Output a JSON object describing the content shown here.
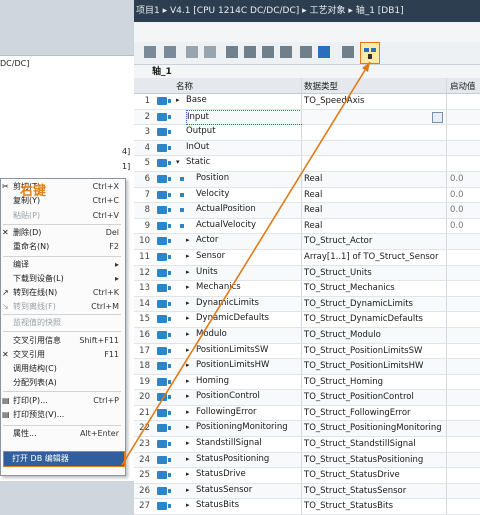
{
  "title_bar": {
    "path": "项目1 ▸ V4.1 [CPU 1214C DC/DC/DC] ▸ 工艺对象 ▸ 轴_1 [DB1]"
  },
  "left_panel": {
    "fragment_top": "DC/DC]",
    "fragment_a": "4]",
    "fragment_b": "1]"
  },
  "editor": {
    "db_name": "轴_1"
  },
  "table": {
    "headers": {
      "name": "名称",
      "type": "数据类型",
      "start": "启动值"
    },
    "rows": [
      {
        "num": "1",
        "name": "Base",
        "type": "TO_SpeedAxis",
        "start": "",
        "level": 0,
        "expander": "▸"
      },
      {
        "num": "2",
        "name": "Input",
        "type": "",
        "start": "",
        "level": 0,
        "expander": ""
      },
      {
        "num": "3",
        "name": "Output",
        "type": "",
        "start": "",
        "level": 0,
        "expander": ""
      },
      {
        "num": "4",
        "name": "InOut",
        "type": "",
        "start": "",
        "level": 0,
        "expander": ""
      },
      {
        "num": "5",
        "name": "Static",
        "type": "",
        "start": "",
        "level": 0,
        "expander": "▾"
      },
      {
        "num": "6",
        "name": "Position",
        "type": "Real",
        "start": "0.0",
        "level": 1,
        "expander": ""
      },
      {
        "num": "7",
        "name": "Velocity",
        "type": "Real",
        "start": "0.0",
        "level": 1,
        "expander": ""
      },
      {
        "num": "8",
        "name": "ActualPosition",
        "type": "Real",
        "start": "0.0",
        "level": 1,
        "expander": ""
      },
      {
        "num": "9",
        "name": "ActualVelocity",
        "type": "Real",
        "start": "0.0",
        "level": 1,
        "expander": ""
      },
      {
        "num": "10",
        "name": "Actor",
        "type": "TO_Struct_Actor",
        "start": "",
        "level": 1,
        "expander": "▸"
      },
      {
        "num": "11",
        "name": "Sensor",
        "type": "Array[1..1] of TO_Struct_Sensor",
        "start": "",
        "level": 1,
        "expander": "▸"
      },
      {
        "num": "12",
        "name": "Units",
        "type": "TO_Struct_Units",
        "start": "",
        "level": 1,
        "expander": "▸"
      },
      {
        "num": "13",
        "name": "Mechanics",
        "type": "TO_Struct_Mechanics",
        "start": "",
        "level": 1,
        "expander": "▸"
      },
      {
        "num": "14",
        "name": "DynamicLimits",
        "type": "TO_Struct_DynamicLimits",
        "start": "",
        "level": 1,
        "expander": "▸"
      },
      {
        "num": "15",
        "name": "DynamicDefaults",
        "type": "TO_Struct_DynamicDefaults",
        "start": "",
        "level": 1,
        "expander": "▸"
      },
      {
        "num": "16",
        "name": "Modulo",
        "type": "TO_Struct_Modulo",
        "start": "",
        "level": 1,
        "expander": "▸"
      },
      {
        "num": "17",
        "name": "PositionLimitsSW",
        "type": "TO_Struct_PositionLimitsSW",
        "start": "",
        "level": 1,
        "expander": "▸"
      },
      {
        "num": "18",
        "name": "PositionLimitsHW",
        "type": "TO_Struct_PositionLimitsHW",
        "start": "",
        "level": 1,
        "expander": "▸"
      },
      {
        "num": "19",
        "name": "Homing",
        "type": "TO_Struct_Homing",
        "start": "",
        "level": 1,
        "expander": "▸"
      },
      {
        "num": "20",
        "name": "PositionControl",
        "type": "TO_Struct_PositionControl",
        "start": "",
        "level": 1,
        "expander": "▸"
      },
      {
        "num": "21",
        "name": "FollowingError",
        "type": "TO_Struct_FollowingError",
        "start": "",
        "level": 1,
        "expander": "▸"
      },
      {
        "num": "22",
        "name": "PositioningMonitoring",
        "type": "TO_Struct_PositioningMonitoring",
        "start": "",
        "level": 1,
        "expander": "▸"
      },
      {
        "num": "23",
        "name": "StandstillSignal",
        "type": "TO_Struct_StandstillSignal",
        "start": "",
        "level": 1,
        "expander": "▸"
      },
      {
        "num": "24",
        "name": "StatusPositioning",
        "type": "TO_Struct_StatusPositioning",
        "start": "",
        "level": 1,
        "expander": "▸"
      },
      {
        "num": "25",
        "name": "StatusDrive",
        "type": "TO_Struct_StatusDrive",
        "start": "",
        "level": 1,
        "expander": "▸"
      },
      {
        "num": "26",
        "name": "StatusSensor",
        "type": "TO_Struct_StatusSensor",
        "start": "",
        "level": 1,
        "expander": "▸"
      },
      {
        "num": "27",
        "name": "StatusBits",
        "type": "TO_Struct_StatusBits",
        "start": "",
        "level": 1,
        "expander": "▸"
      }
    ]
  },
  "annotation": {
    "right_click": "右键"
  },
  "context_menu": {
    "items": [
      {
        "label": "剪切(T)",
        "shortcut": "Ctrl+X",
        "icon": "✂",
        "disabled": false
      },
      {
        "label": "复制(Y)",
        "shortcut": "Ctrl+C",
        "icon": "",
        "disabled": false
      },
      {
        "label": "粘贴(P)",
        "shortcut": "Ctrl+V",
        "icon": "",
        "disabled": true
      },
      {
        "label": "删除(D)",
        "shortcut": "Del",
        "icon": "✕",
        "disabled": false
      },
      {
        "label": "重命名(N)",
        "shortcut": "F2",
        "icon": "",
        "disabled": false
      },
      {
        "label": "编译",
        "shortcut": "▸",
        "icon": "",
        "disabled": false
      },
      {
        "label": "下载到设备(L)",
        "shortcut": "▸",
        "icon": "",
        "disabled": false
      },
      {
        "label": "转到在线(N)",
        "shortcut": "Ctrl+K",
        "icon": "↗",
        "disabled": false
      },
      {
        "label": "转到离线(F)",
        "shortcut": "Ctrl+M",
        "icon": "↘",
        "disabled": true
      },
      {
        "label": "监视值的快照",
        "shortcut": "",
        "icon": "",
        "disabled": true
      },
      {
        "label": "交叉引用信息",
        "shortcut": "Shift+F11",
        "icon": "",
        "disabled": false
      },
      {
        "label": "交叉引用",
        "shortcut": "F11",
        "icon": "✕",
        "disabled": false
      },
      {
        "label": "调用结构(C)",
        "shortcut": "",
        "icon": "",
        "disabled": false
      },
      {
        "label": "分配列表(A)",
        "shortcut": "",
        "icon": "",
        "disabled": false
      },
      {
        "label": "打印(P)...",
        "shortcut": "Ctrl+P",
        "icon": "▤",
        "disabled": false
      },
      {
        "label": "打印预览(V)...",
        "shortcut": "",
        "icon": "▤",
        "disabled": false
      },
      {
        "label": "属性...",
        "shortcut": "Alt+Enter",
        "icon": "",
        "disabled": false
      }
    ],
    "highlighted": "打开 DB 编辑器"
  },
  "colors": {
    "accent": "#e07a18",
    "title_bg": "#2c3e4f",
    "highlight_bg": "#2f5f9c"
  }
}
